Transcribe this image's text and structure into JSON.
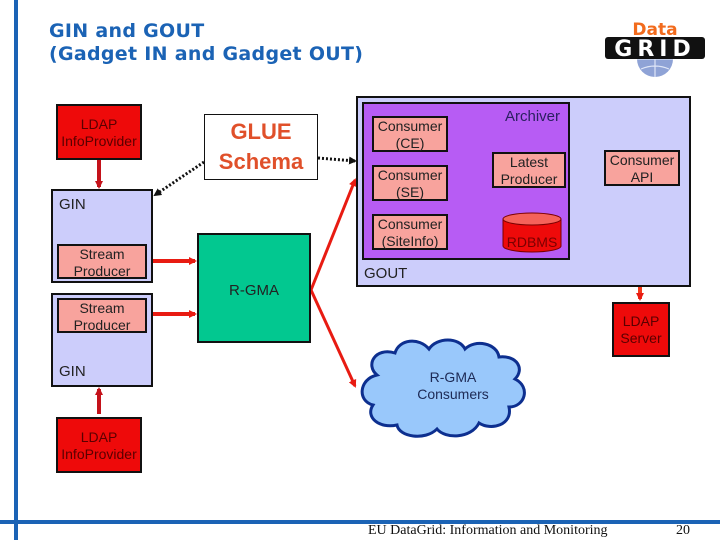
{
  "slide": {
    "title_line1": "GIN and GOUT",
    "title_line2": "(Gadget IN and Gadget OUT)",
    "logo": {
      "top": "Data",
      "bottom": "GRID",
      "icon": "globe-icon"
    },
    "footer": "EU DataGrid: Information and Monitoring",
    "page_number": "20"
  },
  "colors": {
    "accent_blue": "#1b63b5",
    "ldap_red": "#ee0a0a",
    "gin_lavender": "#cccdfb",
    "producer_pink": "#f8a39d",
    "archiver_purple": "#b75cf4",
    "rgma_green": "#02c890",
    "arrow_red": "#e81b12",
    "cloud_blue": "#99c8fb",
    "glue_orange": "#e0502a"
  },
  "diagram": {
    "ldap_info_provider_top": {
      "line1": "LDAP",
      "line2": "InfoProvider"
    },
    "ldap_info_provider_bottom": {
      "line1": "LDAP",
      "line2": "InfoProvider"
    },
    "gin_top": {
      "label": "GIN",
      "producer": {
        "line1": "Stream",
        "line2": "Producer"
      }
    },
    "gin_bottom": {
      "label": "GIN",
      "producer": {
        "line1": "Stream",
        "line2": "Producer"
      }
    },
    "glue_schema": {
      "line1": "GLUE",
      "line2": "Schema"
    },
    "rgma": {
      "label": "R-GMA"
    },
    "gout": {
      "label": "GOUT",
      "archiver": {
        "label": "Archiver",
        "consumers": [
          {
            "line1": "Consumer",
            "line2": "(CE)"
          },
          {
            "line1": "Consumer",
            "line2": "(SE)"
          },
          {
            "line1": "Consumer",
            "line2": "(SiteInfo)"
          }
        ],
        "latest_producer": {
          "line1": "Latest",
          "line2": "Producer"
        },
        "rdbms": "RDBMS"
      },
      "consumer_api": {
        "line1": "Consumer",
        "line2": "API"
      }
    },
    "ldap_server": {
      "line1": "LDAP",
      "line2": "Server"
    },
    "rgma_consumers": {
      "line1": "R-GMA",
      "line2": "Consumers"
    }
  }
}
